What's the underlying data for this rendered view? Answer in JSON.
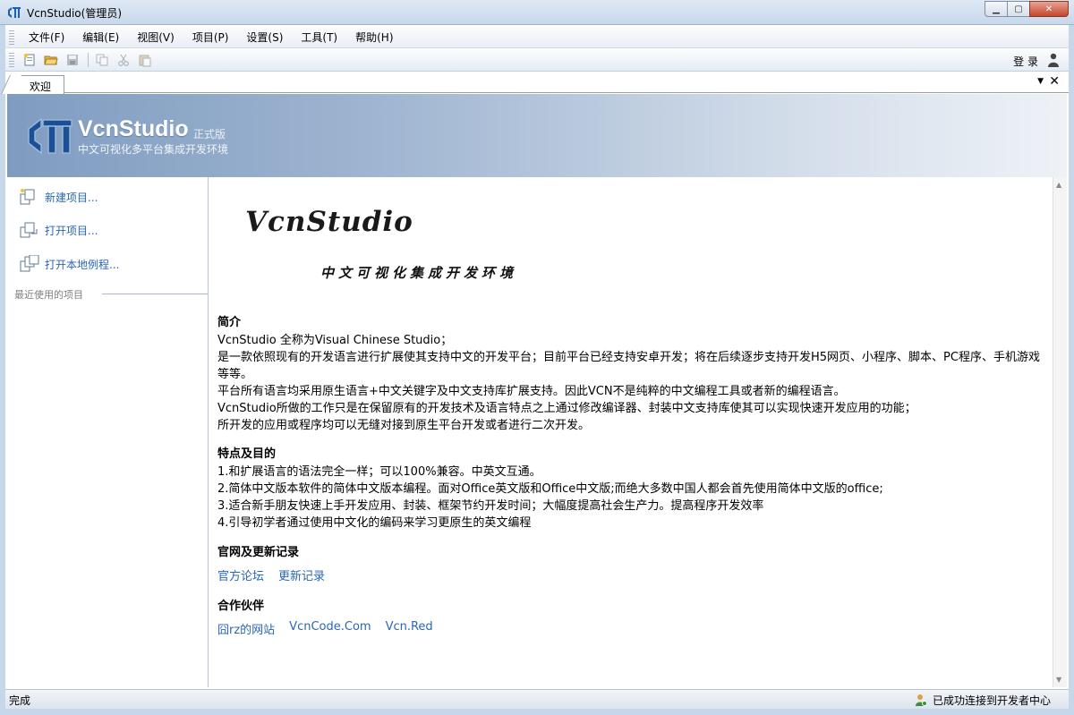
{
  "window": {
    "title": "VcnStudio(管理员)",
    "minimize_icon": "minimize-icon",
    "maximize_icon": "maximize-icon",
    "close_icon": "close-icon"
  },
  "menu": {
    "items": [
      {
        "label": "文件(F)"
      },
      {
        "label": "编辑(E)"
      },
      {
        "label": "视图(V)"
      },
      {
        "label": "项目(P)"
      },
      {
        "label": "设置(S)"
      },
      {
        "label": "工具(T)"
      },
      {
        "label": "帮助(H)"
      }
    ]
  },
  "toolbar": {
    "buttons": [
      "new-file-icon",
      "open-folder-icon",
      "save-icon",
      "copy-icon",
      "cut-icon",
      "paste-icon"
    ],
    "login_label": "登 录",
    "user_icon": "user-icon"
  },
  "tabs": {
    "active": "欢迎"
  },
  "banner": {
    "brand": "VcnStudio",
    "edition": "正式版",
    "subtitle": "中文可视化多平台集成开发环境"
  },
  "sidebar": {
    "actions": [
      {
        "label": "新建项目...",
        "icon": "new-project-icon"
      },
      {
        "label": "打开项目...",
        "icon": "open-project-icon"
      },
      {
        "label": "打开本地例程...",
        "icon": "open-example-icon"
      }
    ],
    "recent_label": "最近使用的项目"
  },
  "content": {
    "logo_text": "VcnStudio",
    "slogan": "中文可视化集成开发环境",
    "intro": {
      "title": "简介",
      "lines": [
        "VcnStudio 全称为Visual Chinese Studio；",
        "是一款依照现有的开发语言进行扩展使其支持中文的开发平台；目前平台已经支持安卓开发；将在后续逐步支持开发H5网页、小程序、脚本、PC程序、手机游戏",
        "等等。",
        "平台所有语言均采用原生语言+中文关键字及中文支持库扩展支持。因此VCN不是纯粹的中文编程工具或者新的编程语言。",
        "VcnStudio所做的工作只是在保留原有的开发技术及语言特点之上通过修改编译器、封装中文支持库使其可以实现快速开发应用的功能；",
        "所开发的应用或程序均可以无缝对接到原生平台开发或者进行二次开发。"
      ]
    },
    "features": {
      "title": "特点及目的",
      "lines": [
        "1.和扩展语言的语法完全一样；可以100%兼容。中英文互通。",
        "2.简体中文版本软件的简体中文版本编程。面对Office英文版和Office中文版;而绝大多数中国人都会首先使用简体中文版的office;",
        "3.适合新手朋友快速上手开发应用、封装、框架节约开发时间；大幅度提高社会生产力。提高程序开发效率",
        "4.引导初学者通过使用中文化的编码来学习更原生的英文编程"
      ]
    },
    "website": {
      "title": "官网及更新记录",
      "links": [
        "官方论坛",
        "更新记录"
      ]
    },
    "partners": {
      "title": "合作伙伴",
      "links": [
        "囧rz的网站",
        "VcnCode.Com",
        "Vcn.Red"
      ]
    }
  },
  "status": {
    "left": "完成",
    "right": "已成功连接到开发者中心",
    "right_icon": "connected-user-icon"
  }
}
